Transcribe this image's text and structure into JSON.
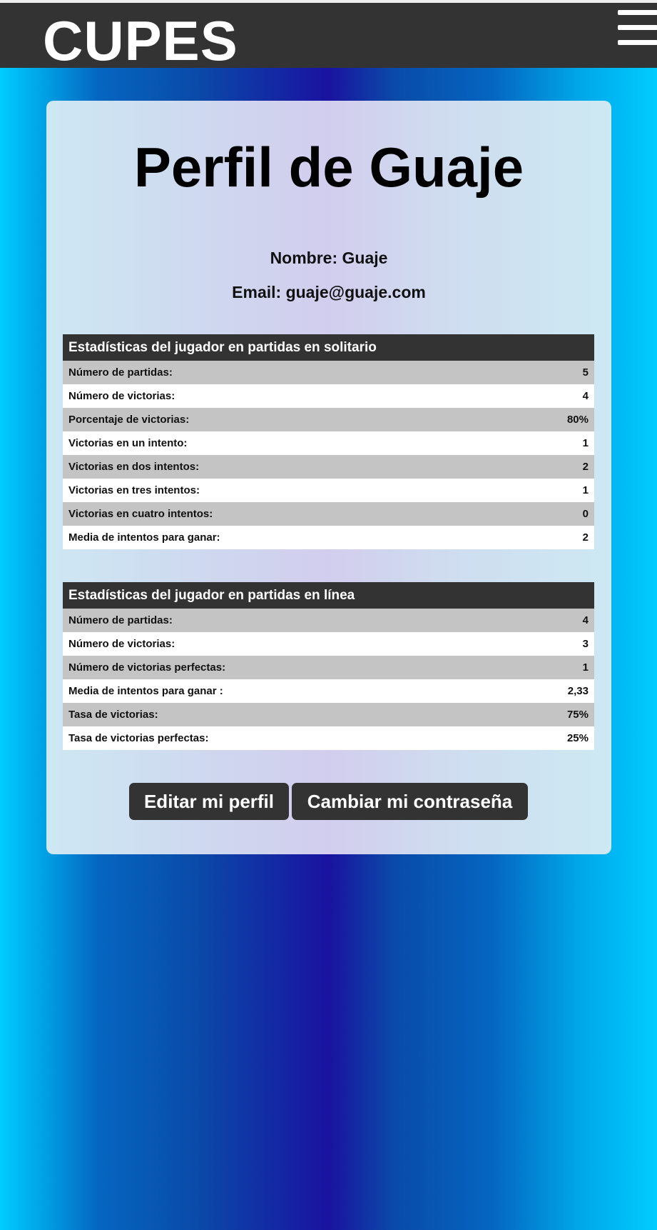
{
  "header": {
    "logo": "CUPES",
    "menu_icon": "hamburger-menu-icon"
  },
  "profile": {
    "title": "Perfil de Guaje",
    "name_line": "Nombre: Guaje",
    "email_line": "Email: guaje@guaje.com"
  },
  "solo_stats": {
    "heading": "Estadísticas del jugador en partidas en solitario",
    "rows": [
      {
        "label": "Número de partidas:",
        "value": "5"
      },
      {
        "label": "Número de victorias:",
        "value": "4"
      },
      {
        "label": "Porcentaje de victorias:",
        "value": "80%"
      },
      {
        "label": "Victorias en un intento:",
        "value": "1"
      },
      {
        "label": "Victorias en dos intentos:",
        "value": "2"
      },
      {
        "label": "Victorias en tres intentos:",
        "value": "1"
      },
      {
        "label": "Victorias en cuatro intentos:",
        "value": "0"
      },
      {
        "label": "Media de intentos para ganar:",
        "value": "2"
      }
    ]
  },
  "online_stats": {
    "heading": "Estadísticas del jugador en partidas en línea",
    "rows": [
      {
        "label": "Número de partidas:",
        "value": "4"
      },
      {
        "label": "Número de victorias:",
        "value": "3"
      },
      {
        "label": "Número de victorias perfectas:",
        "value": "1"
      },
      {
        "label": "Media de intentos para ganar :",
        "value": "2,33"
      },
      {
        "label": "Tasa de victorias:",
        "value": "75%"
      },
      {
        "label": "Tasa de victorias perfectas:",
        "value": "25%"
      }
    ]
  },
  "actions": {
    "edit_label": "Editar mi perfil",
    "change_password_label": "Cambiar mi contraseña"
  },
  "colors": {
    "header_bg": "#333333",
    "row_alt": "#c4c4c4",
    "button_bg": "#333333"
  }
}
